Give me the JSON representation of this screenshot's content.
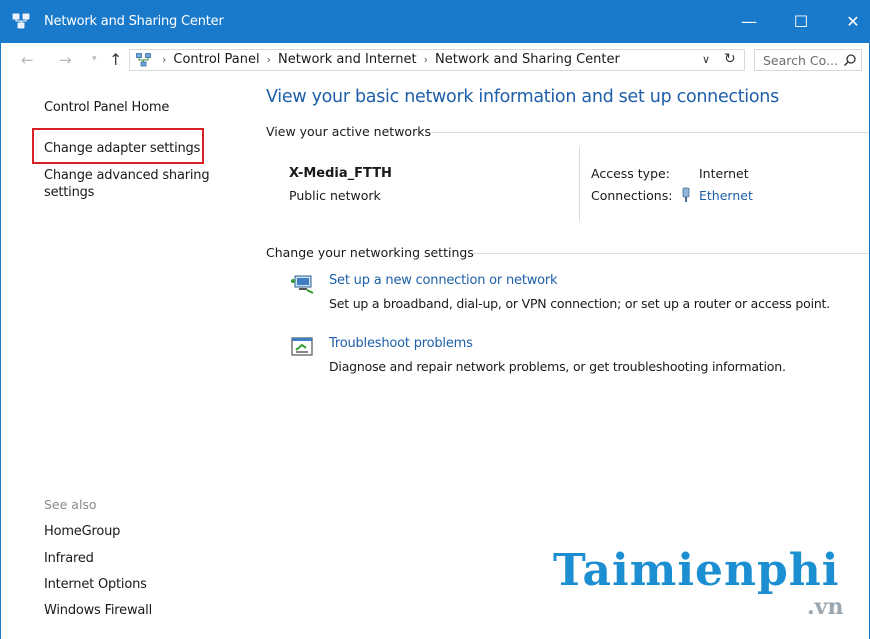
{
  "window": {
    "title": "Network and Sharing Center",
    "controls": {
      "minimize": "—",
      "maximize": "☐",
      "close": "✕"
    }
  },
  "toolbar": {
    "back": "←",
    "forward": "→",
    "recent": "▾",
    "up": "↑",
    "breadcrumbs": [
      "Control Panel",
      "Network and Internet",
      "Network and Sharing Center"
    ],
    "dropdown": "∨",
    "refresh": "↻",
    "search_placeholder": "Search Co..."
  },
  "sidebar": {
    "home": "Control Panel Home",
    "adapter": "Change adapter settings",
    "advanced": "Change advanced sharing settings",
    "see_also_header": "See also",
    "see_also": [
      "HomeGroup",
      "Infrared",
      "Internet Options",
      "Windows Firewall"
    ]
  },
  "main": {
    "title": "View your basic network information and set up connections",
    "active_networks_header": "View your active networks",
    "network": {
      "name": "X-Media_FTTH",
      "type": "Public network",
      "access_type_label": "Access type:",
      "access_type_value": "Internet",
      "connections_label": "Connections:",
      "connections_value": "Ethernet"
    },
    "change_header": "Change your networking settings",
    "tasks": [
      {
        "link": "Set up a new connection or network",
        "desc": "Set up a broadband, dial-up, or VPN connection; or set up a router or access point."
      },
      {
        "link": "Troubleshoot problems",
        "desc": "Diagnose and repair network problems, or get troubleshooting information."
      }
    ]
  },
  "watermark": {
    "main": "Taimienphi",
    "sub": ".vn"
  },
  "colors": {
    "titlebar": "#1979ca",
    "link": "#1e5fa8",
    "highlight": "#d52027"
  }
}
